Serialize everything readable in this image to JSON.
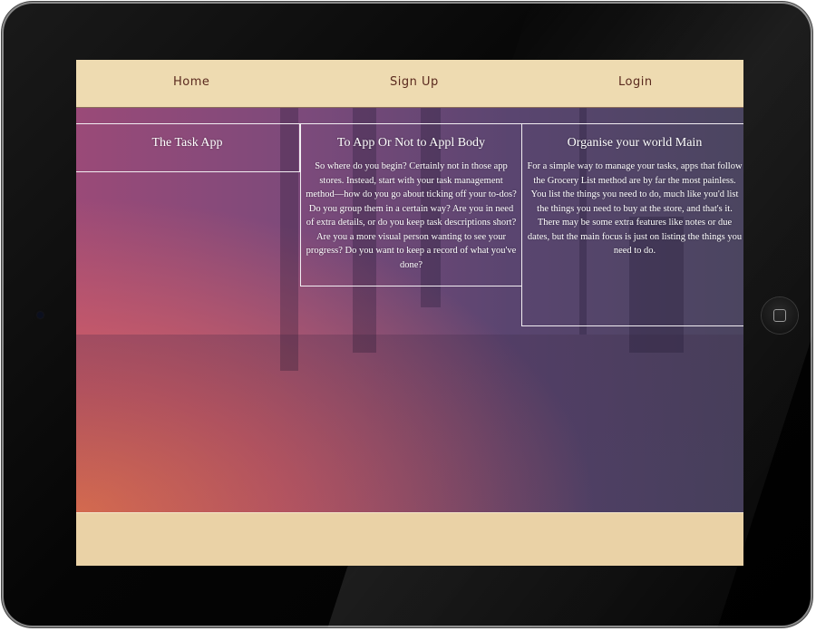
{
  "nav": {
    "home_label": "Home",
    "signup_label": "Sign Up",
    "login_label": "Login"
  },
  "panels": [
    {
      "title": "The Task App",
      "body": ""
    },
    {
      "title": "To App Or Not to Appl Body",
      "body": "So where do you begin? Certainly not in those app stores. Instead, start with your task management method—how do you go about ticking off your to-dos? Do you group them in a certain way? Are you in need of extra details, or do you keep task descriptions short? Are you a more visual person wanting to see your progress? Do you want to keep a record of what you've done?"
    },
    {
      "title": "Organise your world Main",
      "body": "For a simple way to manage your tasks, apps that follow the Grocery List method are by far the most painless. You list the things you need to do, much like you'd list the things you need to buy at the store, and that's it. There may be some extra features like notes or due dates, but the main focus is just on listing the things you need to do."
    }
  ],
  "colors": {
    "nav_bg": "#eedbb1",
    "nav_text": "#5a2a1e",
    "footer_bg": "#ead2a6",
    "hero_warm": "#f67a50",
    "hero_cool": "#5a4570"
  }
}
